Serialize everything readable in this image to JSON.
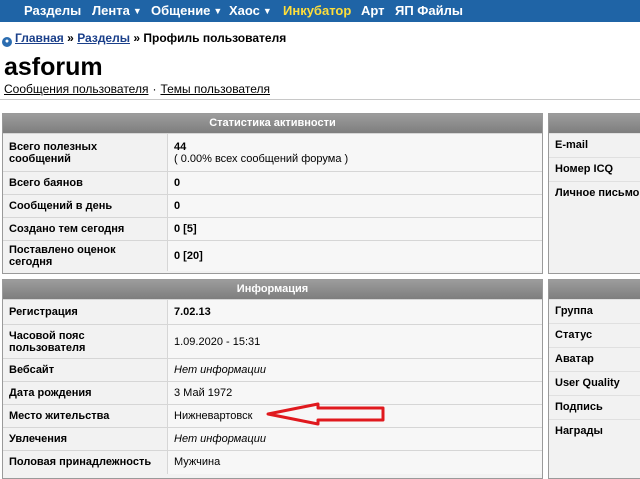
{
  "nav": {
    "items": [
      {
        "label": "Разделы",
        "caret": false,
        "highlight": false
      },
      {
        "label": "Лента",
        "caret": true,
        "highlight": false
      },
      {
        "label": "Общение",
        "caret": true,
        "highlight": false
      },
      {
        "label": "Хаос",
        "caret": true,
        "highlight": false
      },
      {
        "label": "Инкубатор",
        "caret": false,
        "highlight": true
      },
      {
        "label": "Арт",
        "caret": false,
        "highlight": false
      },
      {
        "label": "ЯП Файлы",
        "caret": false,
        "highlight": false
      }
    ],
    "caret_glyph": "▼",
    "bg_color": "#1f64a6",
    "highlight_color": "#ffde3a"
  },
  "breadcrumb": {
    "home": "Главная",
    "sep": "»",
    "sections": "Разделы",
    "current": "Профиль пользователя"
  },
  "profile": {
    "username": "asforum",
    "posts_link": "Сообщения пользователя",
    "dot": "·",
    "topics_link": "Темы пользователя"
  },
  "stats": {
    "title": "Статистика активности",
    "rows": {
      "total": {
        "label": "Всего полезных сообщений",
        "value": "44",
        "sub": "( 0.00% всех сообщений форума )"
      },
      "bans": {
        "label": "Всего баянов",
        "value": "0"
      },
      "per_day": {
        "label": "Сообщений в день",
        "value": "0"
      },
      "topics_today": {
        "label": "Создано тем сегодня",
        "value": "0 [5]"
      },
      "ratings_today": {
        "label": "Поставлено оценок сегодня",
        "value": "0 [20]"
      }
    }
  },
  "info": {
    "title": "Информация",
    "rows": {
      "registration": {
        "label": "Регистрация",
        "value": "7.02.13"
      },
      "timezone": {
        "label": "Часовой пояс пользователя",
        "value": "1.09.2020 - 15:31"
      },
      "website": {
        "label": "Вебсайт",
        "value": "Нет информации"
      },
      "birthday": {
        "label": "Дата рождения",
        "value": "3 Май 1972"
      },
      "location": {
        "label": "Место жительства",
        "value": "Нижневартовск"
      },
      "hobbies": {
        "label": "Увлечения",
        "value": "Нет информации"
      },
      "gender": {
        "label": "Половая принадлежность",
        "value": "Мужчина"
      }
    }
  },
  "contacts": {
    "email": "E-mail",
    "icq": "Номер ICQ",
    "pm": "Личное письмо"
  },
  "extra": {
    "group": "Группа",
    "status": "Статус",
    "avatar": "Аватар",
    "quality": "User Quality",
    "signature": "Подпись",
    "awards": "Награды"
  },
  "annotation": {
    "arrow_color": "#e0191e"
  }
}
